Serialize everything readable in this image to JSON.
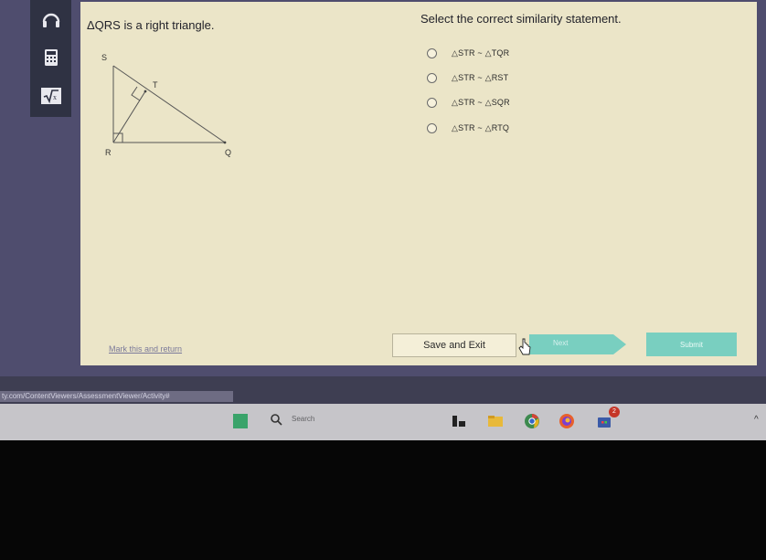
{
  "left_panel": {
    "prompt": "ΔQRS is a right triangle."
  },
  "figure": {
    "labels": {
      "s": "S",
      "t": "T",
      "r": "R",
      "q": "Q"
    }
  },
  "right_panel": {
    "question": "Select the correct similarity statement.",
    "choices": [
      {
        "label": "△STR ~ △TQR"
      },
      {
        "label": "△STR ~ △RST"
      },
      {
        "label": "△STR ~ △SQR"
      },
      {
        "label": "△STR ~ △RTQ"
      }
    ]
  },
  "footer": {
    "mark_link": "Mark this and return",
    "save_exit": "Save and Exit",
    "next": "Next",
    "submit": "Submit"
  },
  "browser": {
    "url": "ty.com/ContentViewers/AssessmentViewer/Activity#"
  },
  "taskbar": {
    "search_placeholder": "Search",
    "notification_count": "2"
  },
  "colors": {
    "content_bg": "#ebe5c8",
    "frame_bg": "#4f4d6e",
    "toolbar_bg": "#2f3243",
    "next_button": "#79cfc0",
    "taskbar_bg": "#c6c5c9"
  },
  "icons": {
    "toolbar": [
      "headphones-icon",
      "calculator-icon",
      "square-root-icon"
    ],
    "taskbar": [
      "widgets-icon",
      "search-icon",
      "task-view-icon",
      "file-explorer-icon",
      "chrome-icon",
      "firefox-icon",
      "store-icon"
    ]
  }
}
